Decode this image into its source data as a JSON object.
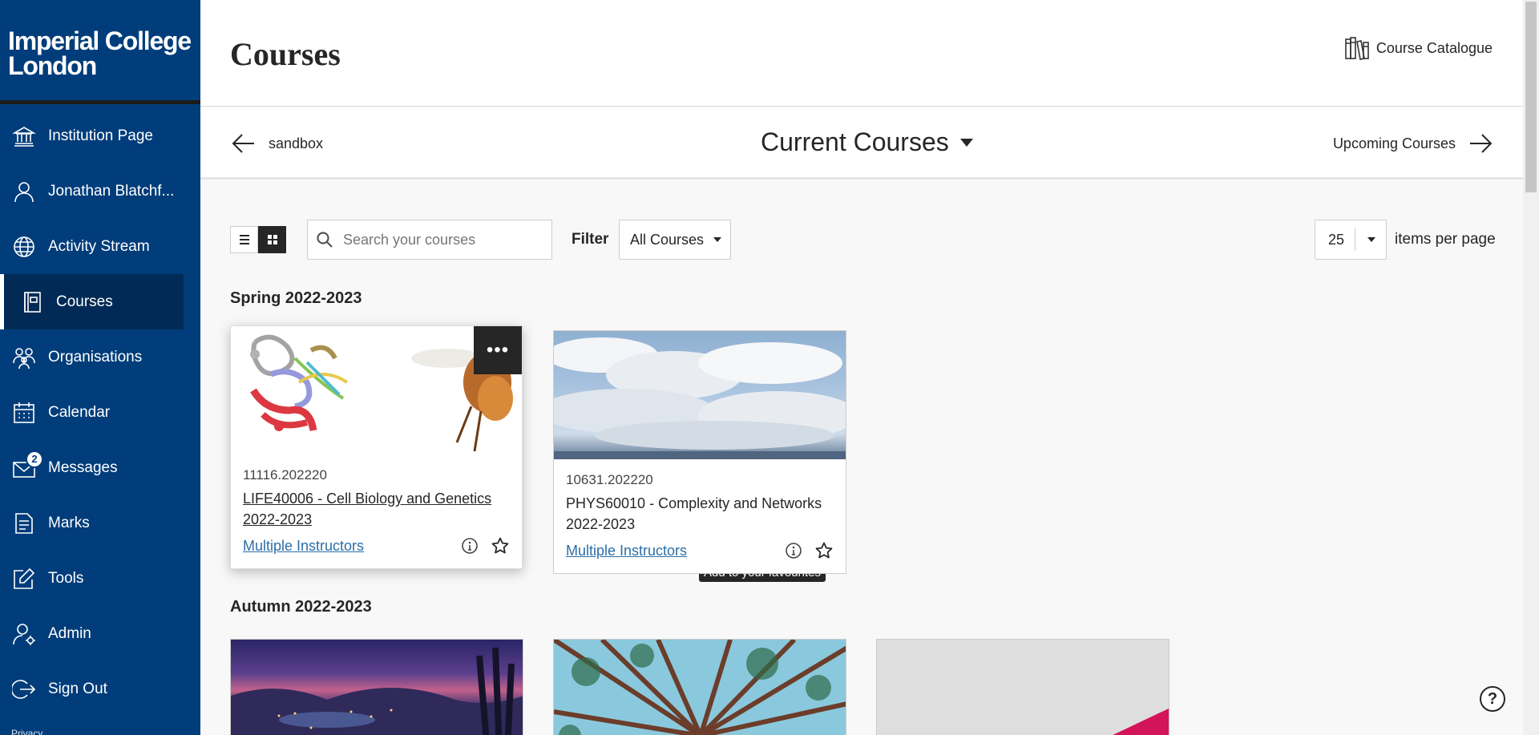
{
  "sidebar": {
    "logo": "Imperial College London",
    "items": [
      {
        "label": "Institution Page"
      },
      {
        "label": "Jonathan Blatchf..."
      },
      {
        "label": "Activity Stream"
      },
      {
        "label": "Courses"
      },
      {
        "label": "Organisations"
      },
      {
        "label": "Calendar"
      },
      {
        "label": "Messages",
        "badge": "2"
      },
      {
        "label": "Marks"
      },
      {
        "label": "Tools"
      },
      {
        "label": "Admin"
      },
      {
        "label": "Sign Out"
      }
    ],
    "privacy": "Privacy"
  },
  "header": {
    "title": "Courses",
    "catalogue": "Course Catalogue"
  },
  "terms": {
    "prev": "sandbox",
    "current": "Current Courses",
    "next": "Upcoming Courses"
  },
  "controls": {
    "search_placeholder": "Search your courses",
    "filter_label": "Filter",
    "filter_value": "All Courses",
    "per_page": "25",
    "per_page_label": "items per page"
  },
  "groups": {
    "spring": "Spring 2022-2023",
    "autumn": "Autumn 2022-2023"
  },
  "courses": [
    {
      "code": "11116.202220",
      "title": "LIFE40006 - Cell Biology and Genetics 2022-2023",
      "instructors": "Multiple Instructors"
    },
    {
      "code": "10631.202220",
      "title": "PHYS60010 - Complexity and Networks 2022-2023",
      "instructors": "Multiple Instructors"
    }
  ],
  "tooltip": "Add to your favourites",
  "colors": {
    "sidebar": "#003d7a",
    "active": "#012b56",
    "link": "#2b6ea8"
  }
}
